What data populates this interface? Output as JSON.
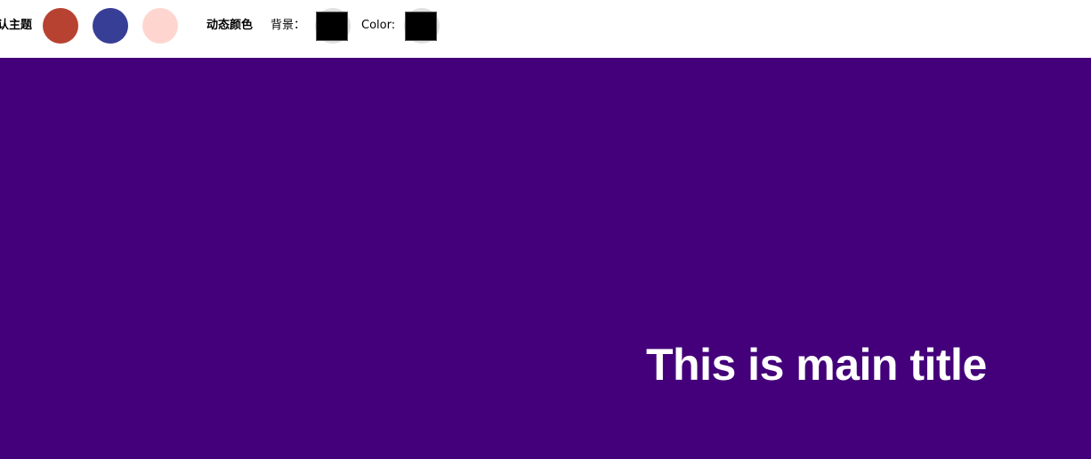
{
  "toolbar": {
    "default_theme_label": "默认主题",
    "themes": [
      {
        "name": "red",
        "color": "#b84231"
      },
      {
        "name": "blue",
        "color": "#373e96"
      },
      {
        "name": "pink",
        "color": "#ffd6cf"
      }
    ],
    "dynamic_color_label": "动态颜色",
    "background_label": "背景：",
    "background_value": "#000000",
    "color_label": "Color:",
    "color_value": "#000000"
  },
  "main": {
    "background": "#44007a",
    "title": "This is main title"
  }
}
